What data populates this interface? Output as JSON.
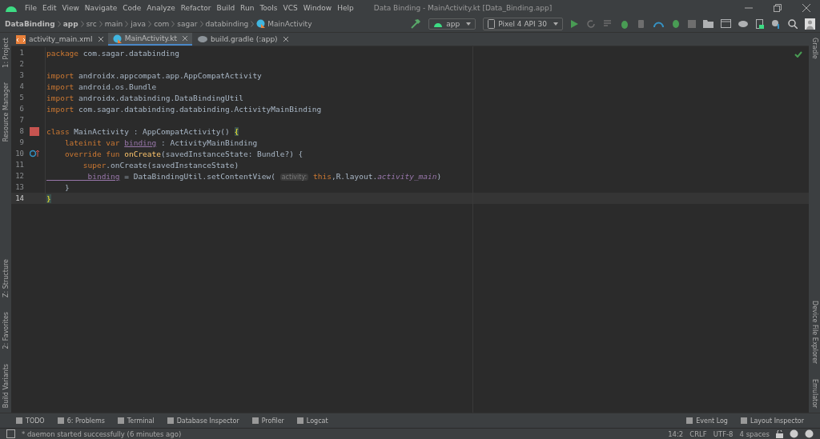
{
  "menu": [
    "File",
    "Edit",
    "View",
    "Navigate",
    "Code",
    "Analyze",
    "Refactor",
    "Build",
    "Run",
    "Tools",
    "VCS",
    "Window",
    "Help"
  ],
  "window": {
    "title": "Data Binding - MainActivity.kt [Data_Binding.app]"
  },
  "breadcrumbs": [
    {
      "label": "DataBinding",
      "bold": true
    },
    {
      "label": "app",
      "bold": true
    },
    {
      "label": "src",
      "bold": false
    },
    {
      "label": "main",
      "bold": false
    },
    {
      "label": "java",
      "bold": false
    },
    {
      "label": "com",
      "bold": false
    },
    {
      "label": "sagar",
      "bold": false
    },
    {
      "label": "databinding",
      "bold": false
    },
    {
      "label": "MainActivity",
      "bold": false
    }
  ],
  "run_config": {
    "module": "app",
    "device": "Pixel 4 API 30"
  },
  "tabs": [
    {
      "label": "activity_main.xml",
      "kind": "xml",
      "selected": false
    },
    {
      "label": "MainActivity.kt",
      "kind": "kotlin",
      "selected": true
    },
    {
      "label": "build.gradle (:app)",
      "kind": "gradle",
      "selected": false
    }
  ],
  "left_tools": [
    "1: Project",
    "Resource Manager"
  ],
  "left_tools_bottom": [
    "Z: Structure",
    "2: Favorites",
    "Build Variants"
  ],
  "right_tools": [
    "Gradle"
  ],
  "right_tools_bottom": [
    "Device File Explorer",
    "Emulator"
  ],
  "editor": {
    "lines": [
      {
        "number": "1",
        "current": false,
        "tokens": [
          {
            "kind": "kw",
            "text": "package"
          },
          {
            "kind": "plain",
            "text": " com.sagar.databinding"
          }
        ]
      },
      {
        "number": "2",
        "current": false
      },
      {
        "number": "3",
        "current": false,
        "tokens": [
          {
            "kind": "kw",
            "text": "import"
          },
          {
            "kind": "plain",
            "text": " androidx.appcompat.app.AppCompatActivity"
          }
        ]
      },
      {
        "number": "4",
        "current": false,
        "tokens": [
          {
            "kind": "kw",
            "text": "import"
          },
          {
            "kind": "plain",
            "text": " android.os.Bundle"
          }
        ]
      },
      {
        "number": "5",
        "current": false,
        "tokens": [
          {
            "kind": "kw",
            "text": "import"
          },
          {
            "kind": "plain",
            "text": " androidx.databinding.DataBindingUtil"
          }
        ]
      },
      {
        "number": "6",
        "current": false,
        "tokens": [
          {
            "kind": "kw",
            "text": "import"
          },
          {
            "kind": "plain",
            "text": " com.sagar.databinding.databinding.ActivityMainBinding"
          }
        ]
      },
      {
        "number": "7",
        "current": false
      },
      {
        "number": "8",
        "current": false,
        "tokens": [
          {
            "kind": "kw",
            "text": "class "
          },
          {
            "kind": "plain",
            "text": "MainActivity : AppCompatActivity() "
          },
          {
            "kind": "brace",
            "text": "{"
          }
        ]
      },
      {
        "number": "9",
        "current": false,
        "tokens": [
          {
            "kind": "kw",
            "text": "    lateinit var "
          },
          {
            "kind": "prop",
            "text": "binding"
          },
          {
            "kind": "plain",
            "text": " : ActivityMainBinding"
          }
        ]
      },
      {
        "number": "10",
        "current": false,
        "tokens": [
          {
            "kind": "kw",
            "text": "    override fun "
          },
          {
            "kind": "fn",
            "text": "onCreate"
          },
          {
            "kind": "plain",
            "text": "(savedInstanceState: Bundle?) {"
          }
        ]
      },
      {
        "number": "11",
        "current": false,
        "tokens": [
          {
            "kind": "kw",
            "text": "        super"
          },
          {
            "kind": "plain",
            "text": ".onCreate(savedInstanceState)"
          }
        ]
      },
      {
        "number": "12",
        "current": false,
        "tokens": [
          {
            "kind": "prop",
            "text": "         binding"
          },
          {
            "kind": "plain",
            "text": " = DataBindingUtil.setContentView( "
          },
          {
            "kind": "hint",
            "text": "activity:"
          },
          {
            "kind": "kw",
            "text": " this"
          },
          {
            "kind": "plain",
            "text": ",R.layout."
          },
          {
            "kind": "static",
            "text": "activity_main"
          },
          {
            "kind": "plain",
            "text": ")"
          }
        ]
      },
      {
        "number": "13",
        "current": false,
        "tokens": [
          {
            "kind": "plain",
            "text": "    }"
          }
        ]
      },
      {
        "number": "14",
        "current": true,
        "tokens": [
          {
            "kind": "brace",
            "text": "}"
          }
        ]
      }
    ]
  },
  "bottom_tools": [
    "TODO",
    "6: Problems",
    "Terminal",
    "Database Inspector",
    "Profiler",
    "Logcat"
  ],
  "bottom_tools_right": [
    "Event Log",
    "Layout Inspector"
  ],
  "status_bar": {
    "message": "* daemon started successfully (6 minutes ago)",
    "position": "14:2",
    "line_separator": "CRLF",
    "encoding": "UTF-8",
    "indent": "4 spaces"
  }
}
